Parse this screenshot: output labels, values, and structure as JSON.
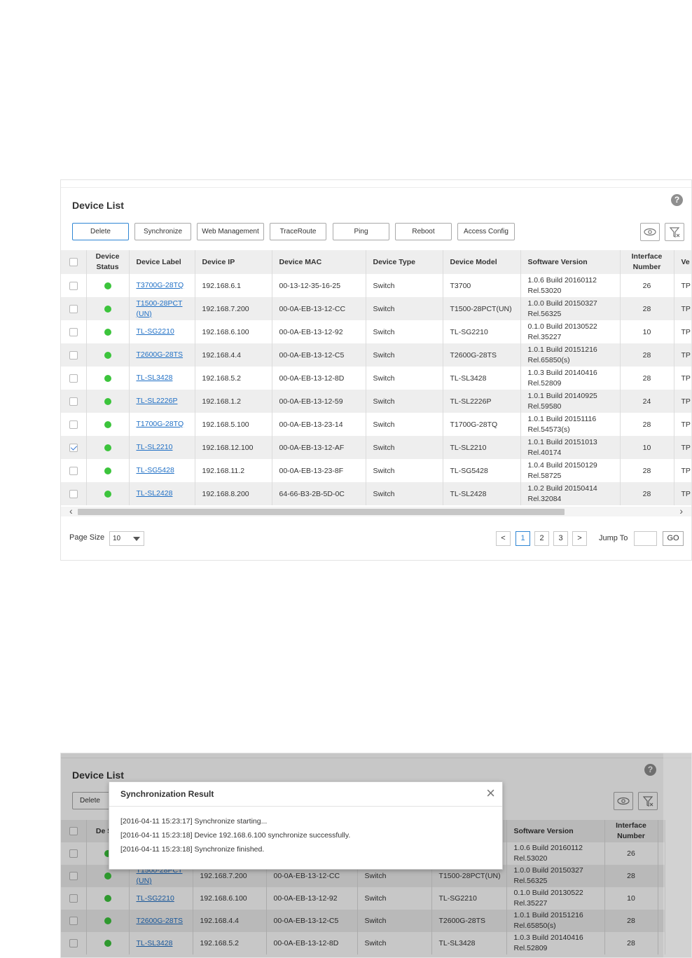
{
  "panel1": {
    "title": "Device List",
    "help": "?",
    "buttons": [
      "Delete",
      "Synchronize",
      "Web Management",
      "TraceRoute",
      "Ping",
      "Reboot",
      "Access Config"
    ],
    "icons": {
      "view": "eye-icon",
      "filter": "filter-icon"
    },
    "columns": [
      "Device Status",
      "Device Label",
      "Device IP",
      "Device MAC",
      "Device Type",
      "Device Model",
      "Software Version",
      "Interface Number",
      "Ve"
    ],
    "rows": [
      {
        "checked": false,
        "label": "T3700G-28TQ",
        "ip": "192.168.6.1",
        "mac": "00-13-12-35-16-25",
        "type": "Switch",
        "model": "T3700",
        "sw1": "1.0.6 Build 20160112",
        "sw2": "Rel.53020",
        "ifn": "26",
        "ve": "TP"
      },
      {
        "checked": false,
        "label": "T1500-28PCT (UN)",
        "ip": "192.168.7.200",
        "mac": "00-0A-EB-13-12-CC",
        "type": "Switch",
        "model": "T1500-28PCT(UN)",
        "sw1": "1.0.0 Build 20150327",
        "sw2": "Rel.56325",
        "ifn": "28",
        "ve": "TP"
      },
      {
        "checked": false,
        "label": "TL-SG2210",
        "ip": "192.168.6.100",
        "mac": "00-0A-EB-13-12-92",
        "type": "Switch",
        "model": "TL-SG2210",
        "sw1": "0.1.0 Build 20130522",
        "sw2": "Rel.35227",
        "ifn": "10",
        "ve": "TP"
      },
      {
        "checked": false,
        "label": "T2600G-28TS",
        "ip": "192.168.4.4",
        "mac": "00-0A-EB-13-12-C5",
        "type": "Switch",
        "model": "T2600G-28TS",
        "sw1": "1.0.1 Build 20151216",
        "sw2": "Rel.65850(s)",
        "ifn": "28",
        "ve": "TP"
      },
      {
        "checked": false,
        "label": "TL-SL3428",
        "ip": "192.168.5.2",
        "mac": "00-0A-EB-13-12-8D",
        "type": "Switch",
        "model": "TL-SL3428",
        "sw1": "1.0.3 Build 20140416",
        "sw2": "Rel.52809",
        "ifn": "28",
        "ve": "TP"
      },
      {
        "checked": false,
        "label": "TL-SL2226P",
        "ip": "192.168.1.2",
        "mac": "00-0A-EB-13-12-59",
        "type": "Switch",
        "model": "TL-SL2226P",
        "sw1": "1.0.1 Build 20140925",
        "sw2": "Rel.59580",
        "ifn": "24",
        "ve": "TP"
      },
      {
        "checked": false,
        "label": "T1700G-28TQ",
        "ip": "192.168.5.100",
        "mac": "00-0A-EB-13-23-14",
        "type": "Switch",
        "model": "T1700G-28TQ",
        "sw1": "1.0.1 Build 20151116",
        "sw2": "Rel.54573(s)",
        "ifn": "28",
        "ve": "TP"
      },
      {
        "checked": true,
        "label": "TL-SL2210",
        "ip": "192.168.12.100",
        "mac": "00-0A-EB-13-12-AF",
        "type": "Switch",
        "model": "TL-SL2210",
        "sw1": "1.0.1 Build 20151013",
        "sw2": "Rel.40174",
        "ifn": "10",
        "ve": "TP"
      },
      {
        "checked": false,
        "label": "TL-SG5428",
        "ip": "192.168.11.2",
        "mac": "00-0A-EB-13-23-8F",
        "type": "Switch",
        "model": "TL-SG5428",
        "sw1": "1.0.4 Build 20150129",
        "sw2": "Rel.58725",
        "ifn": "28",
        "ve": "TP"
      },
      {
        "checked": false,
        "label": "TL-SL2428",
        "ip": "192.168.8.200",
        "mac": "64-66-B3-2B-5D-0C",
        "type": "Switch",
        "model": "TL-SL2428",
        "sw1": "1.0.2 Build 20150414",
        "sw2": "Rel.32084",
        "ifn": "28",
        "ve": "TP"
      }
    ],
    "footer": {
      "page_size_label": "Page Size",
      "page_size_value": "10",
      "pages": [
        "<",
        "1",
        "2",
        "3",
        ">"
      ],
      "active_page": "1",
      "jump_label": "Jump To",
      "go_label": "GO"
    }
  },
  "panel2": {
    "title": "Device List",
    "help": "?",
    "button_partial": "Delete",
    "col_partial": "De Stu",
    "sw_header": "Software Version",
    "ifn_header": "Interface Number",
    "rows": [
      {
        "label": "",
        "ip": "",
        "mac": "",
        "type": "",
        "model": "",
        "sw1": "1.0.6 Build 20160112",
        "sw2": "Rel.53020",
        "ifn": "26"
      },
      {
        "label": "T1500-28PCT (UN)",
        "ip": "192.168.7.200",
        "mac": "00-0A-EB-13-12-CC",
        "type": "Switch",
        "model": "T1500-28PCT(UN)",
        "sw1": "1.0.0 Build 20150327",
        "sw2": "Rel.56325",
        "ifn": "28"
      },
      {
        "label": "TL-SG2210",
        "ip": "192.168.6.100",
        "mac": "00-0A-EB-13-12-92",
        "type": "Switch",
        "model": "TL-SG2210",
        "sw1": "0.1.0 Build 20130522",
        "sw2": "Rel.35227",
        "ifn": "10"
      },
      {
        "label": "T2600G-28TS",
        "ip": "192.168.4.4",
        "mac": "00-0A-EB-13-12-C5",
        "type": "Switch",
        "model": "T2600G-28TS",
        "sw1": "1.0.1 Build 20151216",
        "sw2": "Rel.65850(s)",
        "ifn": "28"
      },
      {
        "label": "TL-SL3428",
        "ip": "192.168.5.2",
        "mac": "00-0A-EB-13-12-8D",
        "type": "Switch",
        "model": "TL-SL3428",
        "sw1": "1.0.3 Build 20140416",
        "sw2": "Rel.52809",
        "ifn": "28"
      }
    ],
    "modal": {
      "title": "Synchronization Result",
      "close": "×",
      "lines": [
        "[2016-04-11 15:23:17] Synchronize starting...",
        "[2016-04-11 15:23:18] Device 192.168.6.100 synchronize successfully.",
        "[2016-04-11 15:23:18] Synchronize finished."
      ]
    }
  }
}
